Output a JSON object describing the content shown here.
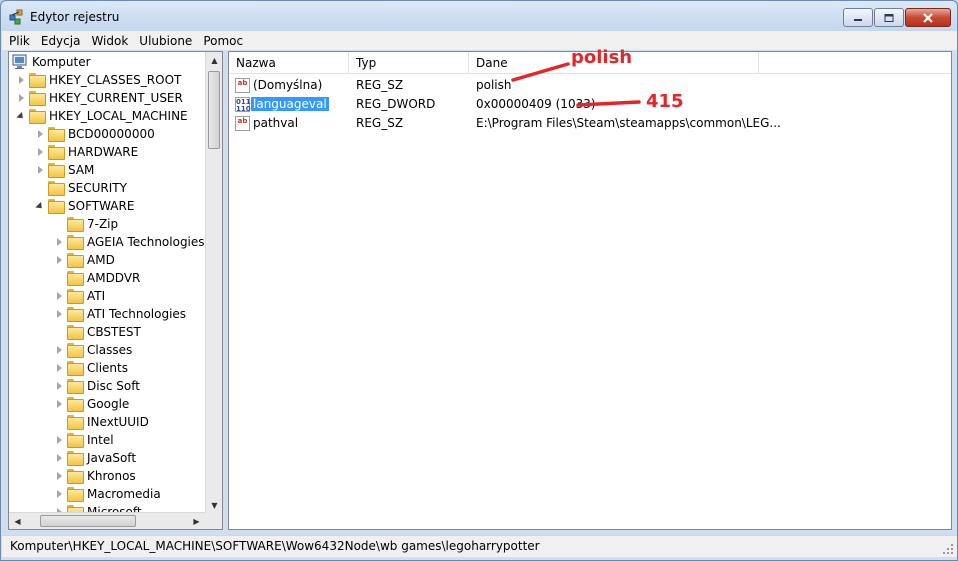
{
  "window": {
    "title": "Edytor rejestru",
    "controls": {
      "minimize": "minimize",
      "maximize": "maximize",
      "close": "close"
    }
  },
  "menu": [
    "Plik",
    "Edycja",
    "Widok",
    "Ulubione",
    "Pomoc"
  ],
  "tree": {
    "root": "Komputer",
    "items": [
      {
        "label": "HKEY_CLASSES_ROOT",
        "level": 1,
        "expander": "closed"
      },
      {
        "label": "HKEY_CURRENT_USER",
        "level": 1,
        "expander": "closed"
      },
      {
        "label": "HKEY_LOCAL_MACHINE",
        "level": 1,
        "expander": "open"
      },
      {
        "label": "BCD00000000",
        "level": 2,
        "expander": "closed"
      },
      {
        "label": "HARDWARE",
        "level": 2,
        "expander": "closed"
      },
      {
        "label": "SAM",
        "level": 2,
        "expander": "closed"
      },
      {
        "label": "SECURITY",
        "level": 2,
        "expander": "none"
      },
      {
        "label": "SOFTWARE",
        "level": 2,
        "expander": "open"
      },
      {
        "label": "7-Zip",
        "level": 3,
        "expander": "none"
      },
      {
        "label": "AGEIA Technologies",
        "level": 3,
        "expander": "closed"
      },
      {
        "label": "AMD",
        "level": 3,
        "expander": "closed"
      },
      {
        "label": "AMDDVR",
        "level": 3,
        "expander": "none"
      },
      {
        "label": "ATI",
        "level": 3,
        "expander": "closed"
      },
      {
        "label": "ATI Technologies",
        "level": 3,
        "expander": "closed"
      },
      {
        "label": "CBSTEST",
        "level": 3,
        "expander": "none"
      },
      {
        "label": "Classes",
        "level": 3,
        "expander": "closed"
      },
      {
        "label": "Clients",
        "level": 3,
        "expander": "closed"
      },
      {
        "label": "Disc Soft",
        "level": 3,
        "expander": "closed"
      },
      {
        "label": "Google",
        "level": 3,
        "expander": "closed"
      },
      {
        "label": "INextUUID",
        "level": 3,
        "expander": "none"
      },
      {
        "label": "Intel",
        "level": 3,
        "expander": "closed"
      },
      {
        "label": "JavaSoft",
        "level": 3,
        "expander": "closed"
      },
      {
        "label": "Khronos",
        "level": 3,
        "expander": "closed"
      },
      {
        "label": "Macromedia",
        "level": 3,
        "expander": "closed"
      },
      {
        "label": "Microsoft",
        "level": 3,
        "expander": "closed"
      }
    ]
  },
  "list": {
    "columns": [
      "Nazwa",
      "Typ",
      "Dane"
    ],
    "rows": [
      {
        "name": "(Domyślna)",
        "type": "REG_SZ",
        "data": "polish",
        "icon": "string-value-icon",
        "selected": false
      },
      {
        "name": "languageval",
        "type": "REG_DWORD",
        "data": "0x00000409 (1033)",
        "icon": "dword-value-icon",
        "selected": true
      },
      {
        "name": "pathval",
        "type": "REG_SZ",
        "data": "E:\\Program Files\\Steam\\steamapps\\common\\LEG...",
        "icon": "string-value-icon",
        "selected": false
      }
    ]
  },
  "annotations": {
    "first": "polish",
    "second": "415",
    "color": "#e52527"
  },
  "status": {
    "path": "Komputer\\HKEY_LOCAL_MACHINE\\SOFTWARE\\Wow6432Node\\wb games\\legoharrypotter"
  },
  "colors": {
    "selection": "#3399ff",
    "window_frame": "#cfdff0",
    "close_button": "#c74a35"
  }
}
